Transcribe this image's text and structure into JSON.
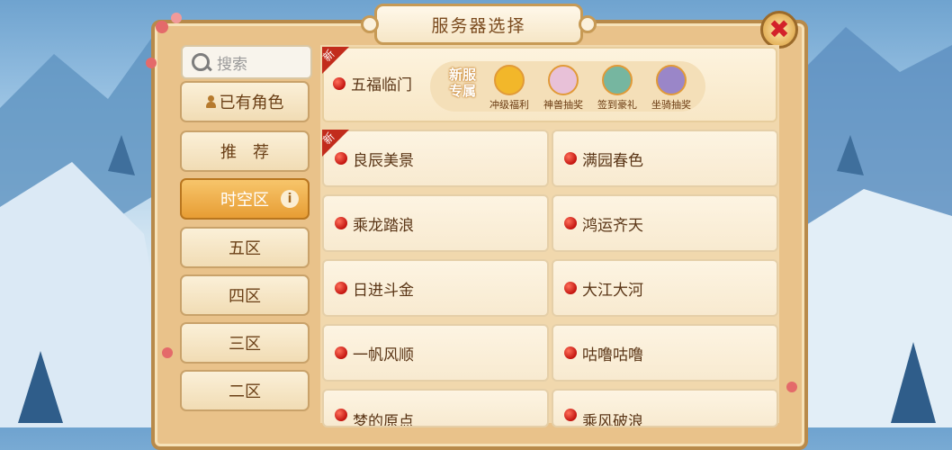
{
  "title": "服务器选择",
  "close_symbol": "✖",
  "search": {
    "placeholder": "搜索"
  },
  "sidebar": {
    "items": [
      {
        "label": "已有角色"
      },
      {
        "label": "推　荐"
      },
      {
        "label": "时空区",
        "active": true,
        "info": "i"
      },
      {
        "label": "五区"
      },
      {
        "label": "四区"
      },
      {
        "label": "三区"
      },
      {
        "label": "二区"
      }
    ]
  },
  "featured": {
    "new_tag": "新",
    "server": "五福临门",
    "promo_title": "新服专属",
    "promos": [
      {
        "label": "冲级福利",
        "icon": "coin-icon",
        "color": "#f2b72a"
      },
      {
        "label": "神兽抽奖",
        "icon": "beast-icon",
        "color": "#e8c1d8"
      },
      {
        "label": "签到豪礼",
        "icon": "dragon-icon",
        "color": "#76b6a0"
      },
      {
        "label": "坐骑抽奖",
        "icon": "mount-icon",
        "color": "#9a86c8"
      }
    ]
  },
  "servers": [
    {
      "name": "良辰美景",
      "new": true,
      "new_tag": "新"
    },
    {
      "name": "满园春色"
    },
    {
      "name": "乘龙踏浪"
    },
    {
      "name": "鸿运齐天"
    },
    {
      "name": "日进斗金"
    },
    {
      "name": "大江大河"
    },
    {
      "name": "一帆风顺"
    },
    {
      "name": "咕噜咕噜"
    },
    {
      "name": "梦的原点"
    },
    {
      "name": "乘风破浪"
    }
  ]
}
